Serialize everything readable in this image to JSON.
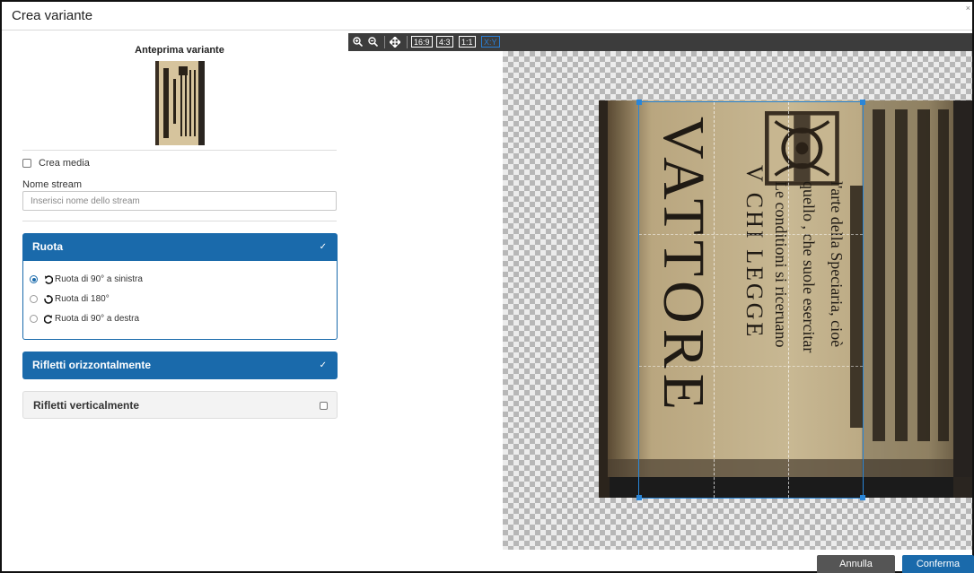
{
  "dialog": {
    "title": "Crea variante",
    "close": "×"
  },
  "preview": {
    "title": "Anteprima variante"
  },
  "create_media": {
    "label": "Crea media",
    "checked": false
  },
  "stream": {
    "label": "Nome stream",
    "placeholder": "Inserisci nome dello stream",
    "value": ""
  },
  "rotate_panel": {
    "title": "Ruota",
    "check": "✓",
    "options": [
      {
        "label": "Ruota di 90° a sinistra",
        "selected": true,
        "icon": "rotate-left-icon"
      },
      {
        "label": "Ruota di 180°",
        "selected": false,
        "icon": "rotate-180-icon"
      },
      {
        "label": "Ruota di 90° a destra",
        "selected": false,
        "icon": "rotate-right-icon"
      }
    ]
  },
  "flip_horizontal": {
    "title": "Rifletti orizzontalmente",
    "check": "✓",
    "active": true
  },
  "flip_vertical": {
    "title": "Rifletti verticalmente",
    "active": false
  },
  "toolbar": {
    "zoom_in_icon": "zoom-in-icon",
    "zoom_out_icon": "zoom-out-icon",
    "move_icon": "move-icon",
    "ratio_16_9": "16:9",
    "ratio_4_3": "4:3",
    "ratio_1_1": "1:1",
    "ratio_xy": "X:Y"
  },
  "image": {
    "lines": [
      "VATTORE",
      "V CHI LEGGE",
      "Le conditioni si riceruano",
      "quello , che suole esercitar",
      "l'arte della Speciaria, cioè"
    ]
  },
  "buttons": {
    "cancel": "Annulla",
    "confirm": "Conferma"
  },
  "colors": {
    "accent": "#1a6aab",
    "toolbar": "#3c3c3c",
    "cancel": "#555555"
  }
}
